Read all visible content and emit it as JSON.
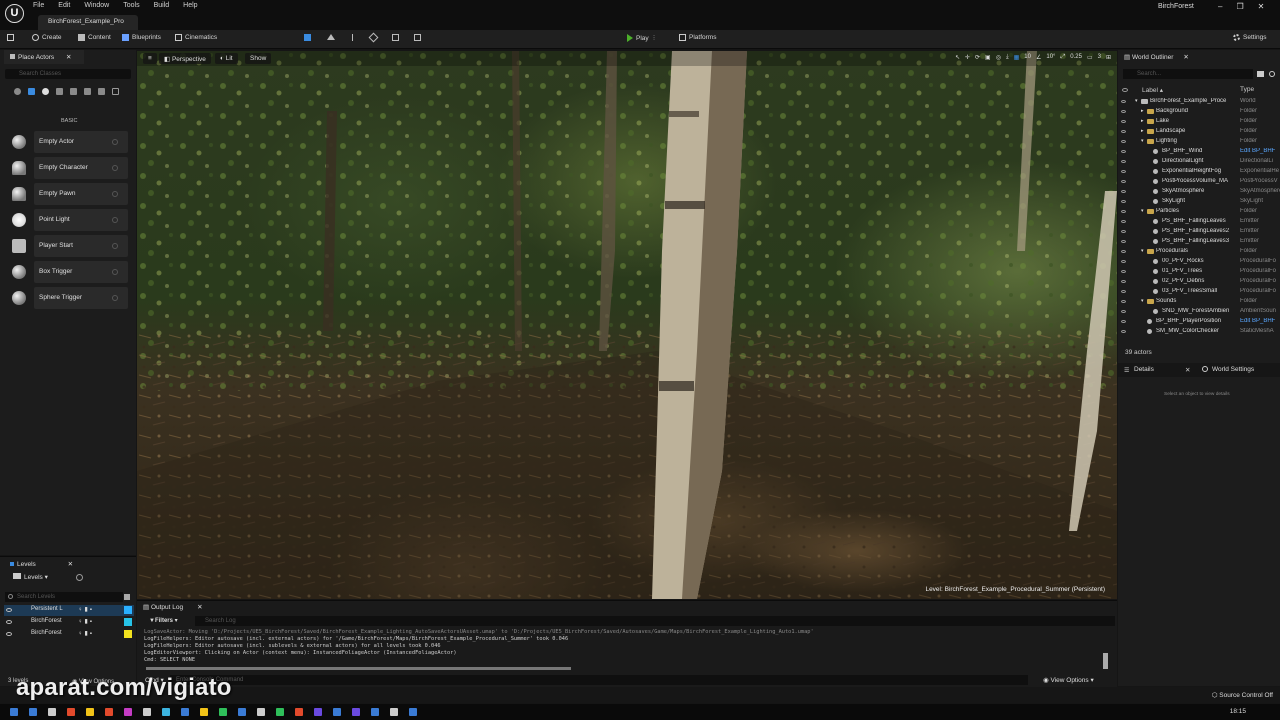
{
  "titlebar": {
    "logo": "U",
    "menu": [
      "File",
      "Edit",
      "Window",
      "Tools",
      "Build",
      "Help"
    ],
    "project_tab": "BirchForest_Example_Pro",
    "window_title": "BirchForest",
    "controls": [
      "–",
      "❐",
      "✕"
    ]
  },
  "toolbar": {
    "create": "Create",
    "content": "Content",
    "blueprints": "Blueprints",
    "cinematics": "Cinematics",
    "play": "Play",
    "platforms": "Platforms",
    "settings": "Settings"
  },
  "place_actors": {
    "tab": "Place Actors",
    "search_placeholder": "Search Classes",
    "category": "BASIC",
    "actors": [
      {
        "label": "Empty Actor",
        "icon": "sphere-icon"
      },
      {
        "label": "Empty Character",
        "icon": "character-icon"
      },
      {
        "label": "Empty Pawn",
        "icon": "pawn-icon"
      },
      {
        "label": "Point Light",
        "icon": "point-light-icon"
      },
      {
        "label": "Player Start",
        "icon": "player-start-icon"
      },
      {
        "label": "Box Trigger",
        "icon": "box-trigger-icon"
      },
      {
        "label": "Sphere Trigger",
        "icon": "sphere-trigger-icon"
      }
    ]
  },
  "levels": {
    "tab": "Levels",
    "dropdown": "Levels",
    "search_placeholder": "Search Levels",
    "rows": [
      {
        "name": "Persistent L",
        "color": "#2ab0ff"
      },
      {
        "name": "BirchForest",
        "color": "#27c3e8"
      },
      {
        "name": "BirchForest",
        "color": "#f2e21f"
      }
    ],
    "count": "3 levels",
    "view_options": "View Options"
  },
  "viewport": {
    "perspective": "Perspective",
    "lit": "Lit",
    "show": "Show",
    "grid_size": "10",
    "rotation": "10°",
    "scale": "0.25",
    "camera_speed": "3",
    "level_label": "Level: BirchForest_Example_Procedural_Summer (Persistent)"
  },
  "output_log": {
    "tab": "Output Log",
    "filters": "Filters",
    "search_placeholder": "Search Log",
    "lines": [
      "LogSaveActor: Moving 'D:/Projects/UE5_BirchForest/Saved/BirchForest_Example_Lighting_AutoSaveActorsUAsset.umap' to 'D:/Projects/UE5_BirchForest/Saved/Autosaves/Game/Maps/BirchForest_Example_Lighting_Auto1.umap'",
      "LogFileHelpers: Editor autosave (incl. external actors) for '/Game/BirchForest/Maps/BirchForest_Example_Procedural_Summer' took 0.046",
      "LogFileHelpers: Editor autosave (incl. sublevels & external actors) for all levels took 0.046",
      "LogEditorViewport: Clicking on Actor (context menu): InstancedFoliageActor (InstancedFoliageActor)",
      "Cmd: SELECT NONE"
    ],
    "cmd_label": "Cmd",
    "cmd_placeholder": "Enter Console Command",
    "view_options": "View Options"
  },
  "outliner": {
    "tab": "World Outliner",
    "search_placeholder": "Search...",
    "col_label": "Label",
    "col_type": "Type",
    "rows": [
      {
        "name": "BirchForest_Example_Proce",
        "type": "World",
        "indent": 0,
        "kind": "world"
      },
      {
        "name": "Background",
        "type": "Folder",
        "indent": 1,
        "kind": "folder"
      },
      {
        "name": "Lake",
        "type": "Folder",
        "indent": 1,
        "kind": "folder"
      },
      {
        "name": "Landscape",
        "type": "Folder",
        "indent": 1,
        "kind": "folder"
      },
      {
        "name": "Lighting",
        "type": "Folder",
        "indent": 1,
        "kind": "folder"
      },
      {
        "name": "BP_BHF_Wind",
        "type": "Edit BP_BHF",
        "indent": 2,
        "kind": "actor",
        "link": true
      },
      {
        "name": "DirectionalLight",
        "type": "DirectionalLi",
        "indent": 2,
        "kind": "actor"
      },
      {
        "name": "ExponentialHeightFog",
        "type": "ExponentialHe",
        "indent": 2,
        "kind": "actor"
      },
      {
        "name": "PostProcessVolume_MA",
        "type": "PostProcessV",
        "indent": 2,
        "kind": "actor"
      },
      {
        "name": "SkyAtmosphere",
        "type": "SkyAtmosphere",
        "indent": 2,
        "kind": "actor"
      },
      {
        "name": "SkyLight",
        "type": "SkyLight",
        "indent": 2,
        "kind": "actor"
      },
      {
        "name": "Particles",
        "type": "Folder",
        "indent": 1,
        "kind": "folder"
      },
      {
        "name": "PS_BHF_FallingLeaves",
        "type": "Emitter",
        "indent": 2,
        "kind": "actor"
      },
      {
        "name": "PS_BHF_FallingLeaves2",
        "type": "Emitter",
        "indent": 2,
        "kind": "actor"
      },
      {
        "name": "PS_BHF_FallingLeaves3",
        "type": "Emitter",
        "indent": 2,
        "kind": "actor"
      },
      {
        "name": "Procedurals",
        "type": "Folder",
        "indent": 1,
        "kind": "folder"
      },
      {
        "name": "00_PFV_Rocks",
        "type": "ProceduralFo",
        "indent": 2,
        "kind": "actor"
      },
      {
        "name": "01_PFV_Trees",
        "type": "ProceduralFo",
        "indent": 2,
        "kind": "actor"
      },
      {
        "name": "02_PFV_Debris",
        "type": "ProceduralFo",
        "indent": 2,
        "kind": "actor"
      },
      {
        "name": "03_PFV_TreesSmall",
        "type": "ProceduralFo",
        "indent": 2,
        "kind": "actor"
      },
      {
        "name": "Sounds",
        "type": "Folder",
        "indent": 1,
        "kind": "folder"
      },
      {
        "name": "SND_MW_ForestAmbien",
        "type": "AmbientSoun",
        "indent": 2,
        "kind": "actor"
      },
      {
        "name": "BP_BHF_PlayerPosition",
        "type": "Edit BP_BHF",
        "indent": 1,
        "kind": "actor",
        "link": true
      },
      {
        "name": "SM_MW_ColorChecker",
        "type": "StaticMeshA",
        "indent": 1,
        "kind": "actor"
      }
    ],
    "count": "39 actors"
  },
  "details": {
    "tab": "Details",
    "world_settings": "World Settings",
    "hint": "Select an object to view details"
  },
  "statusbar": {
    "source_control": "Source Control Off"
  },
  "taskbar": {
    "clock": "18:15",
    "icon_colors": [
      "#3a7bd5",
      "#3a7bd5",
      "#cccccc",
      "#e24a2c",
      "#f2c318",
      "#e24a2c",
      "#c43cc4",
      "#cccccc",
      "#3cb4e0",
      "#3a7bd5",
      "#f2c318",
      "#2fbf5a",
      "#3a7bd5",
      "#cccccc",
      "#2fbf5a",
      "#e24a2c",
      "#6a4ae0",
      "#3a7bd5",
      "#6a4ae0",
      "#3a7bd5",
      "#cccccc",
      "#3a7bd5"
    ]
  },
  "watermark": "aparat.com/vigiato"
}
